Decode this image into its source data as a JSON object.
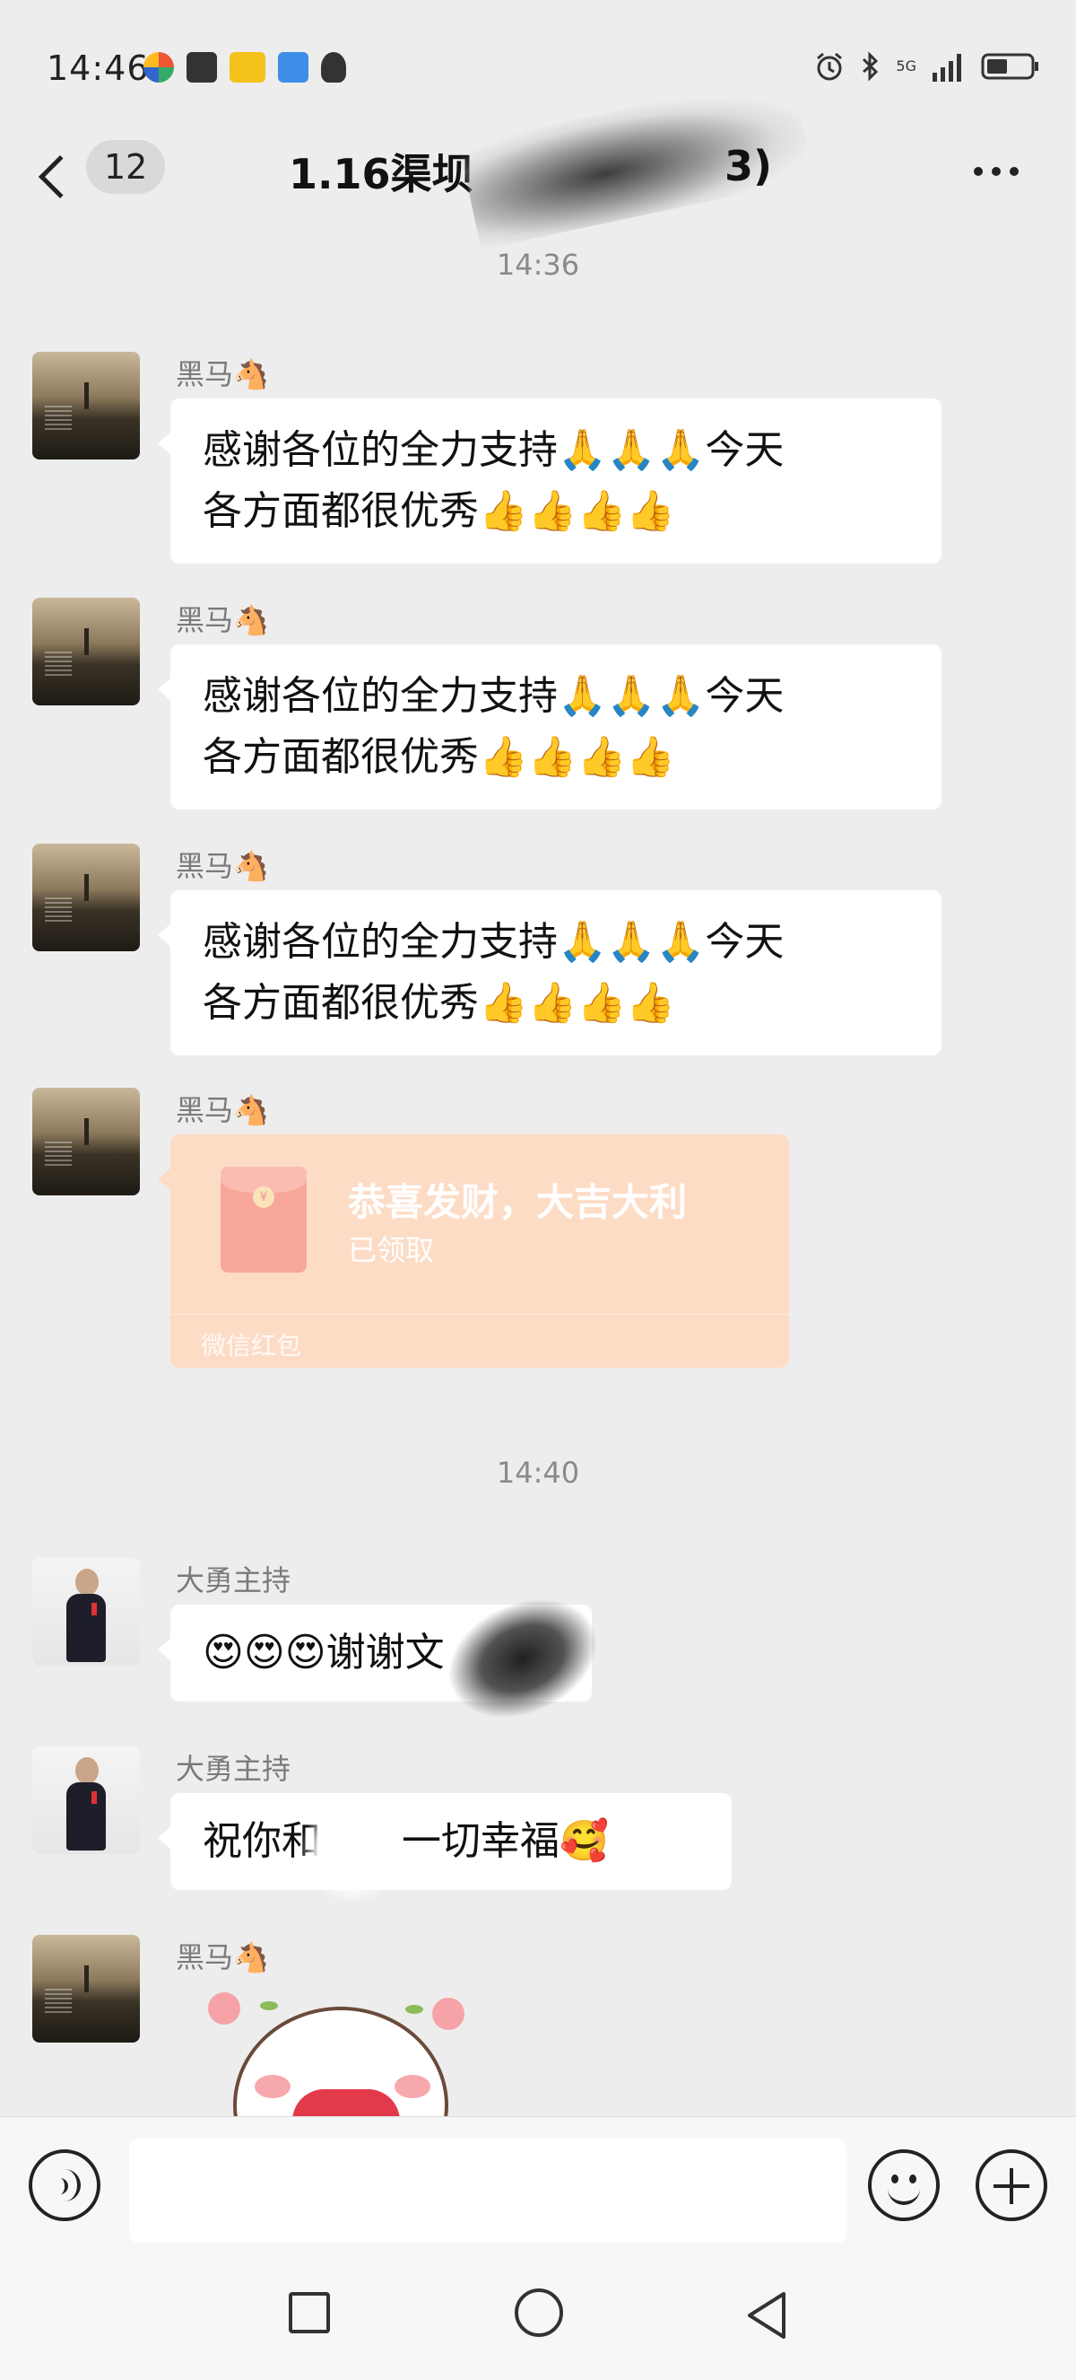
{
  "status_bar": {
    "time": "14:46",
    "network": "5G",
    "icons_left": [
      "colorful-app-icon",
      "upload-icon",
      "app-badge-icon",
      "shield-app-icon",
      "qq-penguin-icon"
    ],
    "icons_right": [
      "alarm-icon",
      "bluetooth-icon",
      "signal-icon",
      "battery-icon"
    ]
  },
  "header": {
    "unread_count": "12",
    "title_prefix": "1.16渠坝",
    "title_suffix": "3)"
  },
  "timestamps": [
    "14:36",
    "14:40"
  ],
  "messages": [
    {
      "sender": "黑马🐴",
      "line1": "感谢各位的全力支持",
      "emoji1": "🙏🙏🙏",
      "line1b": "今天",
      "line2": "各方面都很优秀",
      "emoji2": "👍👍👍👍"
    },
    {
      "sender": "黑马🐴",
      "line1": "感谢各位的全力支持",
      "emoji1": "🙏🙏🙏",
      "line1b": "今天",
      "line2": "各方面都很优秀",
      "emoji2": "👍👍👍👍"
    },
    {
      "sender": "黑马🐴",
      "line1": "感谢各位的全力支持",
      "emoji1": "🙏🙏🙏",
      "line1b": "今天",
      "line2": "各方面都很优秀",
      "emoji2": "👍👍👍👍"
    }
  ],
  "red_packet": {
    "sender": "黑马🐴",
    "title": "恭喜发财，大吉大利",
    "status": "已领取",
    "footer": "微信红包"
  },
  "host_messages": [
    {
      "sender": "大勇主持",
      "emoji": "😍😍😍",
      "text": "谢谢文"
    },
    {
      "sender": "大勇主持",
      "text_a": "祝你和",
      "text_b": "一切幸福",
      "emoji": "🥰"
    }
  ],
  "last_sender": "黑马🐴",
  "colors": {
    "background": "#ededed",
    "bubble": "#ffffff",
    "red_packet": "#fddcc6",
    "timestamp": "#8a8a8a"
  }
}
